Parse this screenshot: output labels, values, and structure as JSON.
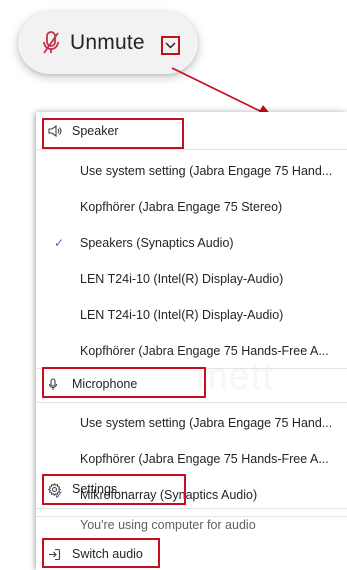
{
  "call_button": {
    "label": "Unmute",
    "icon": "microphone-off-icon",
    "dropdown_icon": "chevron-down-icon"
  },
  "menu": {
    "speaker_header": "Speaker",
    "speaker_items": [
      "Use system setting (Jabra Engage 75 Hand...",
      "Kopfhörer (Jabra Engage 75 Stereo)",
      "Speakers (Synaptics Audio)",
      "LEN T24i-10 (Intel(R) Display-Audio)",
      "LEN T24i-10 (Intel(R) Display-Audio)",
      "Kopfhörer (Jabra Engage 75 Hands-Free A..."
    ],
    "microphone_header": "Microphone",
    "microphone_items": [
      "Use system setting (Jabra Engage 75 Hand...",
      "Kopfhörer (Jabra Engage 75 Hands-Free A...",
      "Mikrofonarray (Synaptics Audio)"
    ],
    "settings_label": "Settings...",
    "info_text": "You're using computer for audio",
    "switch_audio_label": "Switch audio",
    "watermark_text": "mett"
  },
  "colors": {
    "highlight": "#c50f1f",
    "check": "#5b5fc7",
    "mic_off": "#c4314b"
  }
}
